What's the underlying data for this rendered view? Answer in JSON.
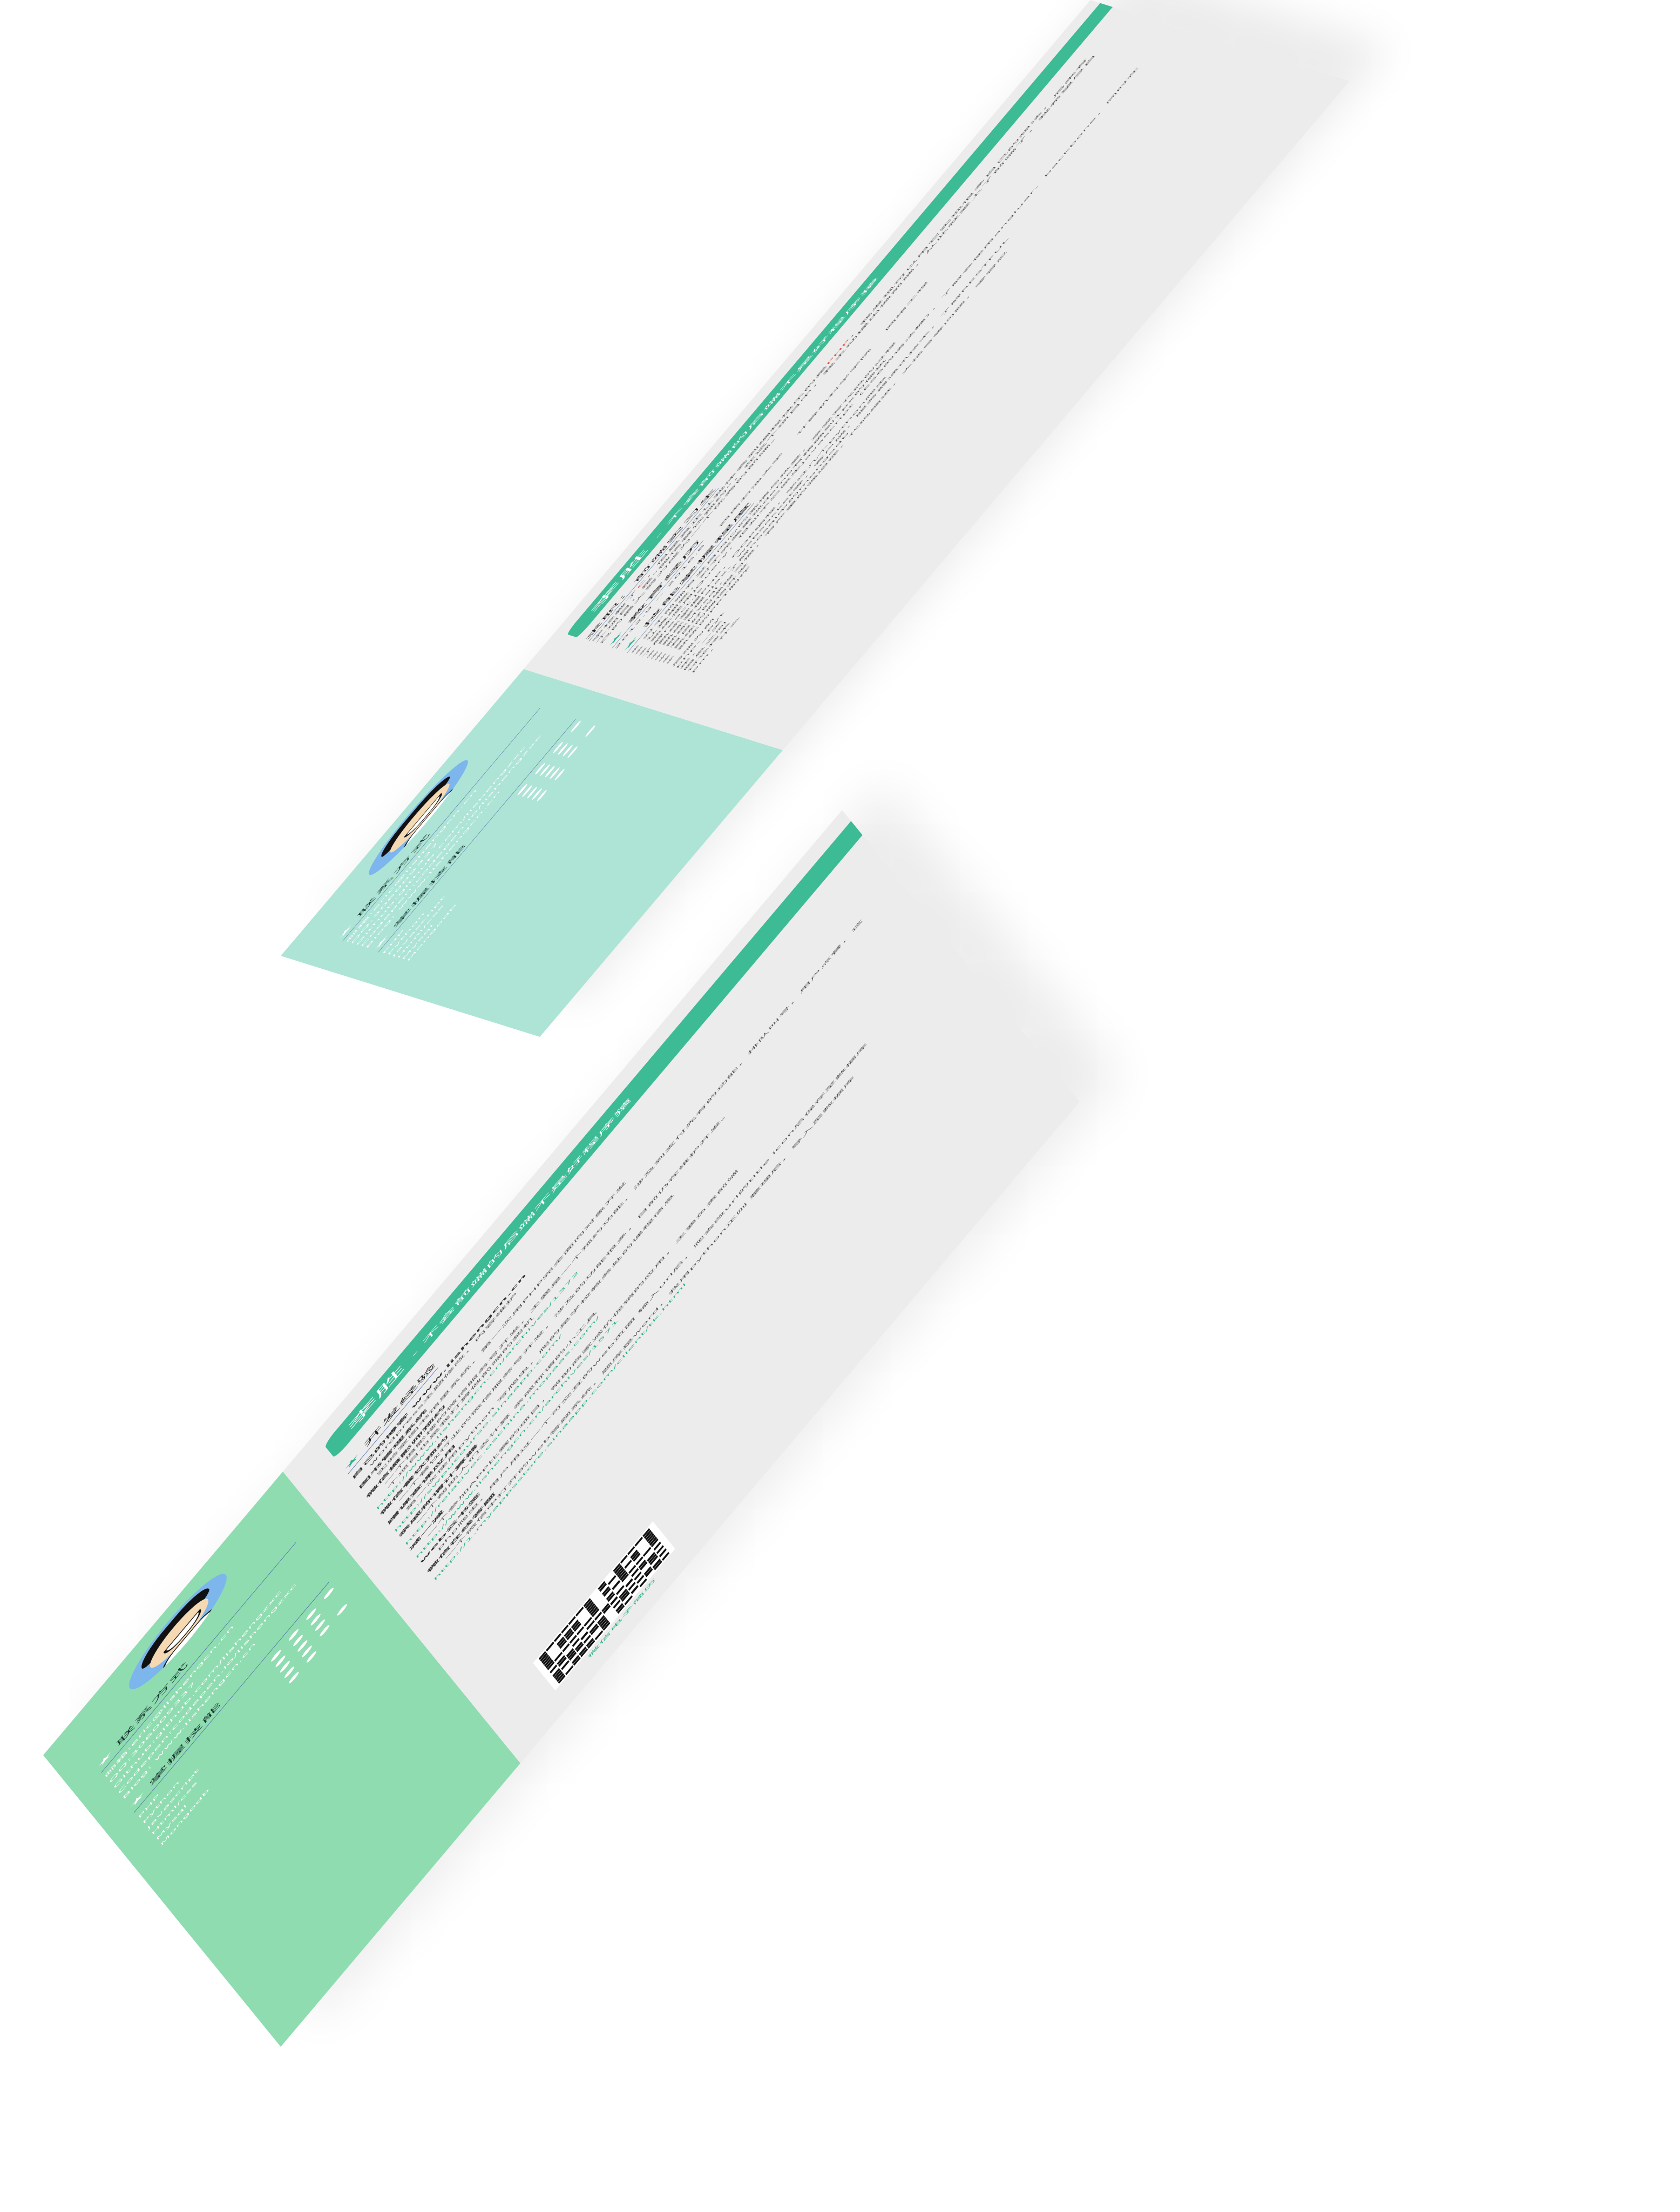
{
  "resume_front": {
    "name": "李胜",
    "tagline": "- 不会前端的后端不是好程序猿",
    "contact_heading": "联系方式",
    "contacts": [
      "邮箱:eric@lishengcn.cn",
      "QQ:306009337",
      "Github:github.com/lishengzxc",
      "Codepen:codepen.io/lishengzxc",
      "Blog: www.lishengcn.cn"
    ],
    "skills_heading": "掌握技能",
    "skills": [
      "PHP",
      "Python",
      "Javascript",
      "Html/css",
      "Mysql",
      "Mongodb"
    ],
    "job_title": "求职：前端实习生",
    "intro_part1": "学校教了",
    "intro_c": "C",
    "intro_part2": "，但是真正让我体会到编程快乐的是",
    "intro_php": "PHP",
    "intro_part3": "，我发现可以用它实现很多自己的想法，后来有个项目，是“微信餐饮预约”，在这个项目中，我主动提出做前端，从此就爱上了前端了，我希望尽自己的最大努力成为一个优秀的前端。",
    "education_heading": "教育经历",
    "education": {
      "dates": "2012.9 ~ 2016.6",
      "school": "西南石油大学",
      "college": "计算机科学学院",
      "major": "网络工程"
    },
    "skill_level_heading": "技能掌握程度",
    "skill_items": [
      "※ 对于前端有发自内心的激情与热爱，享受写代码的过程",
      "※ 认真细致，对于完美重现demo有精确到1px的偏执",
      "※ 熟练使用jQuery，但却不忘原生javascript（ES6的语法糖），了解会使用angluar、backbone，同时在了解react.js",
      "※ 熟练掌握PHP，OOP编程，学过几个python爬虫",
      "※ 熟练掌握ajax、websocket等，客户端，服务器通讯技术，了解RESTFUL",
      "※ 熟练Mysql，了解nosql中的mongodb",
      "※ 有良好的编程习惯，有严重的强迫症，代码缩进，大括号等问题，零容忍",
      "※ 熟练的微信开发",
      "※ 熟练的PPT制作"
    ],
    "partial_lines": [
      "后端为前",
      "php、pyt",
      "年，一天",
      "瞬息之间",
      "讨论技术",
      "pm，什么"
    ]
  },
  "resume_back": {
    "name": "李胜",
    "tagline": "- 不会前端的后端不是好程序猿",
    "contact_heading": "联系方式",
    "contacts": [
      "邮箱:eric@lishengcn.cn",
      "QQ:306009337",
      "Github:github.com/lishengzxc",
      "Codepen:codepen.io/lishengzxc",
      "Blog: www.lishengcn.cn"
    ],
    "skills_heading": "掌握技能",
    "skills": [
      "PHP",
      "Python",
      "Javascript",
      "Html/css",
      "Mysql",
      "Mongodb"
    ],
    "dev_heading": "开发经验",
    "projects": [
      {
        "title": "自己的博客 www.lishengcn.cn",
        "desc": "wordpress主题修改，内容维护",
        "link": ""
      },
      {
        "title": "图书管理系统",
        "desc": "实验室图书馆里系统，第一次用PHP完全面向对象开发",
        "link": ""
      },
      {
        "title": "微信摄影师预约",
        "desc": "一个摄影楼的微信服务号开发，主要是一个预约功能，涉及到支付先有的功能，排队叫号，用户点餐，这个项目也是我打算做前端的契机",
        "link": "http://www.lishengcn.cn/archives/1372"
      },
      {
        "title": "微信餐饮预约",
        "desc": "一个餐饮行业的微信服务号开发，涉及的功能很多，目前仍在维护开发。",
        "link": ""
      },
      {
        "title": "蹭课查课应用",
        "desc": "第一次使用python 写爬虫，爬的是学校教务处的课程信息",
        "link": "http://swpucourse.sinaapp.com/"
      },
      {
        "title": "亲戚称谓计算器",
        "desc": "一个帮助人们去计算 亲戚称谓的小工具",
        "link": "http://relativec.oschina.mopaas.com/"
      },
      {
        "title": "减一减",
        "desc": "一个参加APP比赛的项目，帮助商家减价促销的应用，主要负责前端",
        "link": "http://www.lishengcn.cn/archives/1571"
      },
      {
        "title": "web云书签",
        "desc": "php爬虫，用户用过一个可交互的web页面 输入url后，爬去改url的title icon后保存至数据库",
        "link": ""
      },
      {
        "title": "微信在线答题",
        "desc": "一个微信中打开的web答题系统，题库是word，我用python正则 整理后，导入至数据库",
        "link": "http://1.myappsstore.sinaapp.com/client/tk.html"
      }
    ],
    "qr_caption": "微信电子简历"
  },
  "colors": {
    "sidebar_front": "#ade4d6",
    "sidebar_back": "#8fdcb0",
    "banner": "#3dbb94",
    "accent": "#2fb08a",
    "main_bg": "#ececec",
    "rule": "#4f6fa8"
  }
}
